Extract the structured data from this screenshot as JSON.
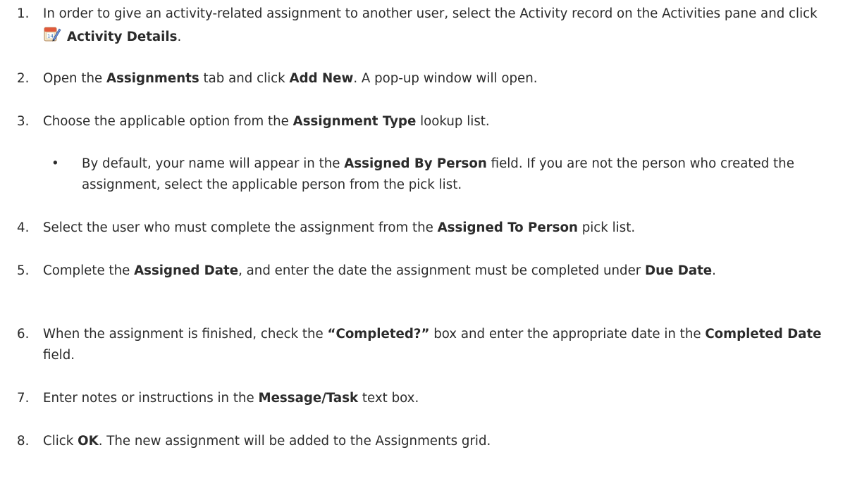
{
  "steps": [
    {
      "number": "1.",
      "parts": [
        {
          "t": "In order to give an activity-related assignment to another user, select the Activity record on the Activities pane and click "
        },
        {
          "icon": "activity-details-icon"
        },
        {
          "t": "Activity Details",
          "b": true
        },
        {
          "t": "."
        }
      ]
    },
    {
      "number": "2.",
      "parts": [
        {
          "t": "Open the "
        },
        {
          "t": "Assignments",
          "b": true
        },
        {
          "t": " tab and click "
        },
        {
          "t": "Add New",
          "b": true
        },
        {
          "t": ". A pop-up window will open."
        }
      ]
    },
    {
      "number": "3.",
      "parts": [
        {
          "t": "Choose the applicable option from the "
        },
        {
          "t": "Assignment Type",
          "b": true
        },
        {
          "t": " lookup list."
        }
      ],
      "bullets": [
        [
          {
            "t": "By default, your name will appear in the "
          },
          {
            "t": "Assigned By Person",
            "b": true
          },
          {
            "t": " field. If you are not the person who created the assignment, select the applicable person from the pick list."
          }
        ]
      ]
    },
    {
      "number": "4.",
      "parts": [
        {
          "t": "Select the user who must complete the assignment from the "
        },
        {
          "t": "Assigned To Person",
          "b": true
        },
        {
          "t": " pick list."
        }
      ]
    },
    {
      "number": "5.",
      "parts": [
        {
          "t": "Complete the "
        },
        {
          "t": "Assigned Date",
          "b": true
        },
        {
          "t": ", and enter the date the assignment must be completed under "
        },
        {
          "t": "Due Date",
          "b": true
        },
        {
          "t": "."
        }
      ]
    },
    {
      "number": "6.",
      "parts": [
        {
          "t": "When the assignment is finished, check the "
        },
        {
          "t": "“Completed?”",
          "b": true
        },
        {
          "t": " box and enter the appropriate date in the "
        },
        {
          "t": "Completed Date",
          "b": true
        },
        {
          "t": " field."
        }
      ]
    },
    {
      "number": "7.",
      "parts": [
        {
          "t": "Enter notes or instructions in the "
        },
        {
          "t": "Message/Task",
          "b": true
        },
        {
          "t": " text box."
        }
      ]
    },
    {
      "number": "8.",
      "parts": [
        {
          "t": "Click "
        },
        {
          "t": "OK",
          "b": true
        },
        {
          "t": ". The new assignment will be added to the Assignments grid."
        }
      ]
    }
  ],
  "bullet_glyph": "•",
  "icon_date_text": "14"
}
